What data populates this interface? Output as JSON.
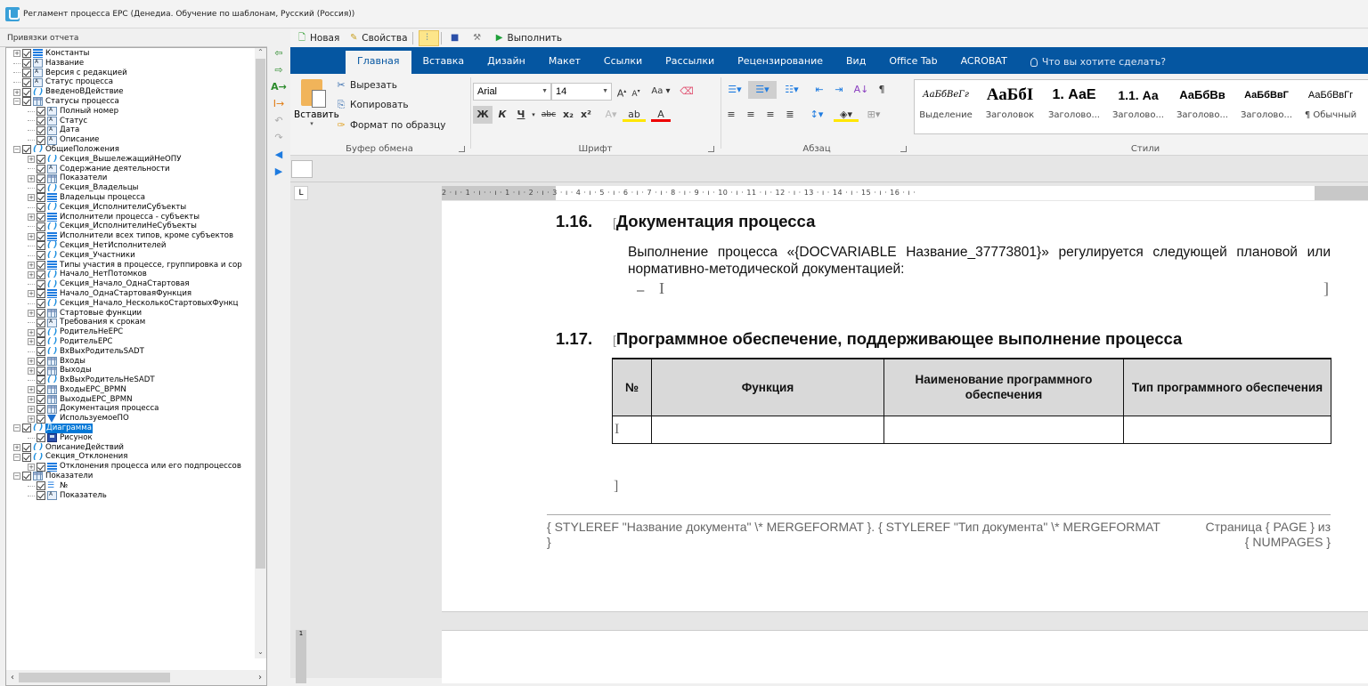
{
  "window": {
    "title": "Регламент процесса EPC (Денедиа. Обучение по шаблонам, Русский (Россия))",
    "icon": "app-icon"
  },
  "left_panel": {
    "header": "Привязки отчета",
    "tree": [
      {
        "label": "Константы",
        "icon": "list",
        "depth": 0,
        "expander": "+"
      },
      {
        "label": "Название",
        "icon": "text",
        "depth": 0,
        "expander": ""
      },
      {
        "label": "Версия с редакцией",
        "icon": "text",
        "depth": 0,
        "expander": ""
      },
      {
        "label": "Статус процесса",
        "icon": "text",
        "depth": 0,
        "expander": ""
      },
      {
        "label": "ВведеноВДействие",
        "icon": "sect",
        "depth": 0,
        "expander": "+"
      },
      {
        "label": "Статусы процесса",
        "icon": "table",
        "depth": 0,
        "expander": "-"
      },
      {
        "label": "Полный номер",
        "icon": "text",
        "depth": 1,
        "expander": ""
      },
      {
        "label": "Статус",
        "icon": "text",
        "depth": 1,
        "expander": ""
      },
      {
        "label": "Дата",
        "icon": "text",
        "depth": 1,
        "expander": ""
      },
      {
        "label": "Описание",
        "icon": "text",
        "depth": 1,
        "expander": ""
      },
      {
        "label": "ОбщиеПоложения",
        "icon": "sect",
        "depth": 0,
        "expander": "-"
      },
      {
        "label": "Секция_ВышележащийНеОПУ",
        "icon": "sect",
        "depth": 1,
        "expander": "+"
      },
      {
        "label": "Содержание деятельности",
        "icon": "text",
        "depth": 1,
        "expander": ""
      },
      {
        "label": "Показатели",
        "icon": "table",
        "depth": 1,
        "expander": "+"
      },
      {
        "label": "Секция_Владельцы",
        "icon": "sect",
        "depth": 1,
        "expander": ""
      },
      {
        "label": "Владельцы процесса",
        "icon": "list",
        "depth": 1,
        "expander": "+"
      },
      {
        "label": "Секция_ИсполнителиСубъекты",
        "icon": "sect",
        "depth": 1,
        "expander": ""
      },
      {
        "label": "Исполнители процесса - субъекты",
        "icon": "list",
        "depth": 1,
        "expander": "+"
      },
      {
        "label": "Секция_ИсполнителиНеСубъекты",
        "icon": "sect",
        "depth": 1,
        "expander": ""
      },
      {
        "label": "Исполнители всех типов, кроме субъектов",
        "icon": "list",
        "depth": 1,
        "expander": "+"
      },
      {
        "label": "Секция_НетИсполнителей",
        "icon": "sect",
        "depth": 1,
        "expander": ""
      },
      {
        "label": "Секция_Участники",
        "icon": "sect",
        "depth": 1,
        "expander": ""
      },
      {
        "label": "Типы участия в процессе, группировка и сор",
        "icon": "list",
        "depth": 1,
        "expander": "+"
      },
      {
        "label": "Начало_НетПотомков",
        "icon": "sect",
        "depth": 1,
        "expander": "+"
      },
      {
        "label": "Секция_Начало_ОднаСтартовая",
        "icon": "sect",
        "depth": 1,
        "expander": ""
      },
      {
        "label": "Начало_ОднаСтартоваяФункция",
        "icon": "list",
        "depth": 1,
        "expander": "+"
      },
      {
        "label": "Секция_Начало_НесколькоСтартовыхФункц",
        "icon": "sect",
        "depth": 1,
        "expander": ""
      },
      {
        "label": "Стартовые функции",
        "icon": "table",
        "depth": 1,
        "expander": "+"
      },
      {
        "label": "Требования к срокам",
        "icon": "text",
        "depth": 1,
        "expander": ""
      },
      {
        "label": "РодительНеЕРС",
        "icon": "sect",
        "depth": 1,
        "expander": "+"
      },
      {
        "label": "РодительЕРС",
        "icon": "sect",
        "depth": 1,
        "expander": "+"
      },
      {
        "label": "ВхВыхРодительSADT",
        "icon": "sect",
        "depth": 1,
        "expander": ""
      },
      {
        "label": "Входы",
        "icon": "table",
        "depth": 1,
        "expander": "+"
      },
      {
        "label": "Выходы",
        "icon": "table",
        "depth": 1,
        "expander": "+"
      },
      {
        "label": "ВхВыхРодительНеSADT",
        "icon": "sect",
        "depth": 1,
        "expander": ""
      },
      {
        "label": "ВходыЕРС_BPMN",
        "icon": "table",
        "depth": 1,
        "expander": "+"
      },
      {
        "label": "ВыходыЕРС_BPMN",
        "icon": "table",
        "depth": 1,
        "expander": "+"
      },
      {
        "label": "Документация процесса",
        "icon": "table",
        "depth": 1,
        "expander": "+"
      },
      {
        "label": "ИспользуемоеПО",
        "icon": "filter",
        "depth": 1,
        "expander": "+"
      },
      {
        "label": "Диаграмма",
        "icon": "sect",
        "depth": 0,
        "expander": "-",
        "selected": true
      },
      {
        "label": "Рисунок",
        "icon": "pic",
        "depth": 1,
        "expander": ""
      },
      {
        "label": "ОписаниеДействий",
        "icon": "sect",
        "depth": 0,
        "expander": "+"
      },
      {
        "label": "Секция_Отклонения",
        "icon": "sect",
        "depth": 0,
        "expander": "-"
      },
      {
        "label": "Отклонения процесса или его подпроцессов",
        "icon": "list",
        "depth": 1,
        "expander": "+"
      },
      {
        "label": "Показатели",
        "icon": "table",
        "depth": 0,
        "expander": "-"
      },
      {
        "label": "№",
        "icon": "num",
        "depth": 1,
        "expander": ""
      },
      {
        "label": "Показатель",
        "icon": "text",
        "depth": 1,
        "expander": ""
      }
    ]
  },
  "side_tools": [
    "find-prev-icon",
    "find-next-icon",
    "replace-icon",
    "insert-field-icon",
    "undo-field-icon",
    "redo-field-icon",
    "arrow-left-icon",
    "arrow-right-icon"
  ],
  "toolbar": {
    "new_label": "Новая",
    "properties_label": "Свойства",
    "run_label": "Выполнить"
  },
  "ribbon_tabs": [
    "Главная",
    "Вставка",
    "Дизайн",
    "Макет",
    "Ссылки",
    "Рассылки",
    "Рецензирование",
    "Вид",
    "Office Tab",
    "ACROBAT"
  ],
  "tell_me": "Что вы хотите сделать?",
  "clipboard": {
    "paste": "Вставить",
    "cut": "Вырезать",
    "copy": "Копировать",
    "format_painter": "Формат по образцу",
    "group": "Буфер обмена"
  },
  "font": {
    "name": "Arial",
    "size": "14",
    "group": "Шрифт",
    "bold": "Ж",
    "italic": "К",
    "underline": "Ч",
    "strike": "abc",
    "sub": "x₂",
    "sup": "x²",
    "case": "Aa"
  },
  "paragraph": {
    "group": "Абзац"
  },
  "styles": {
    "group": "Стили",
    "items": [
      {
        "preview": "АаБбВеГг",
        "name": "Выделение"
      },
      {
        "preview": "АаБбІ",
        "name": "Заголовок"
      },
      {
        "preview": "1.  АаЕ",
        "name": "Заголово..."
      },
      {
        "preview": "1.1.  Аа",
        "name": "Заголово..."
      },
      {
        "preview": "АаБбВв",
        "name": "Заголово..."
      },
      {
        "preview": "АаБбВвГ",
        "name": "Заголово..."
      },
      {
        "preview": "АаБбВвГг",
        "name": "¶ Обычный"
      }
    ]
  },
  "ruler": {
    "text": "2 · ı · 1 · ı ·      · ı · 1 · ı · 2 · ı · 3 · ı · 4 · ı · 5 · ı · 6 · ı · 7 · ı · 8 · ı · 9 · ı · 10 · ı · 11 · ı · 12 · ı · 13 · ı · 14 · ı · 15 · ı · 16 · ı ·",
    "tab_selector": "L",
    "vertical": "1"
  },
  "document": {
    "section1": {
      "number": "1.16.",
      "title": "Документация процесса"
    },
    "paragraph": "Выполнение процесса «{DOCVARIABLE Название_37773801}» регулируется следующей плановой или нормативно-методической документацией:",
    "bullet": "–",
    "section2": {
      "number": "1.17.",
      "title": "Программное обеспечение, поддерживающее выполнение процесса"
    },
    "table": {
      "headers": [
        "№",
        "Функция",
        "Наименование программного обеспечения",
        "Тип программного обеспечения"
      ],
      "rows": [
        [
          "",
          "",
          "",
          ""
        ]
      ]
    },
    "footer_left": "{ STYLEREF  \"Название документа\"  \\* MERGEFORMAT }. { STYLEREF  \"Тип документа\"  \\* MERGEFORMAT }",
    "footer_right_1": "Страница { PAGE } из",
    "footer_right_2": "{ NUMPAGES }"
  }
}
